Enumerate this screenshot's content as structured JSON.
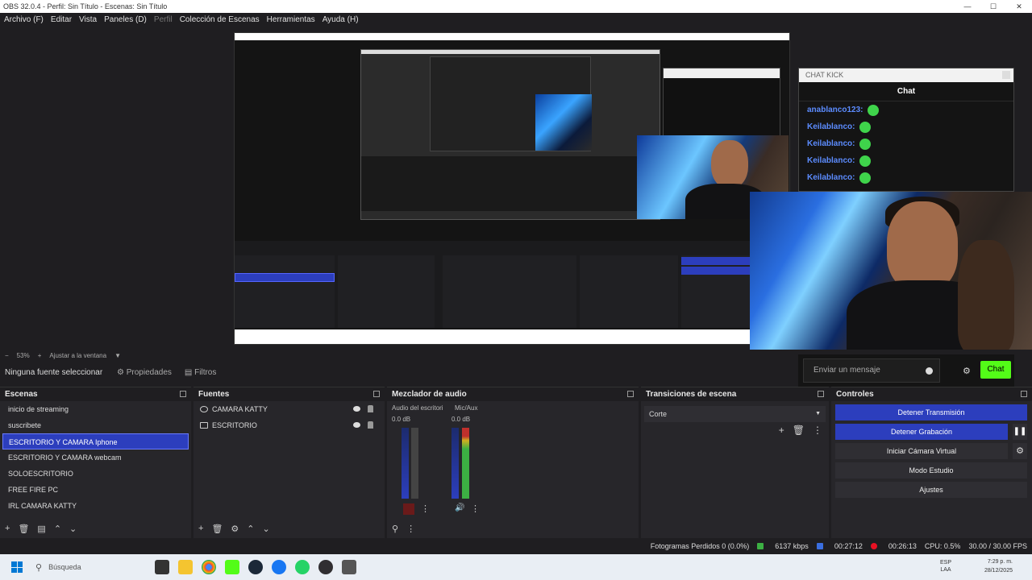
{
  "window": {
    "title": "OBS 32.0.4 - Perfil: Sin Título - Escenas: Sin Título"
  },
  "menu": [
    "Archivo (F)",
    "Editar",
    "Vista",
    "Paneles (D)",
    "Perfil",
    "Colección de Escenas",
    "Herramientas",
    "Ayuda (H)"
  ],
  "chat": {
    "window_title": "CHAT KICK",
    "header": "Chat",
    "messages": [
      {
        "user": "anablanco123:"
      },
      {
        "user": "Keilablanco:"
      },
      {
        "user": "Keilablanco:"
      },
      {
        "user": "Keilablanco:"
      },
      {
        "user": "Keilablanco:"
      }
    ],
    "input_placeholder": "Enviar un mensaje",
    "send_label": "Chat"
  },
  "zoom": {
    "value": "53%",
    "fit_label": "Ajustar a la ventana"
  },
  "source_toolbar": {
    "none_label": "Ninguna fuente seleccionar",
    "properties": "Propiedades",
    "filters": "Filtros"
  },
  "scenes": {
    "title": "Escenas",
    "items": [
      "inicio de streaming",
      "suscribete",
      "ESCRITORIO Y CAMARA Iphone",
      "ESCRITORIO Y CAMARA webcam",
      "SOLOESCRITORIO",
      "FREE FIRE PC",
      "IRL CAMARA KATTY"
    ],
    "selected_index": 2
  },
  "sources": {
    "title": "Fuentes",
    "items": [
      "CAMARA KATTY",
      "ESCRITORIO"
    ]
  },
  "mixer": {
    "title": "Mezclador de audio",
    "channels": [
      {
        "name": "Audio del escritori",
        "db": "0.0 dB"
      },
      {
        "name": "Mic/Aux",
        "db": "0.0 dB"
      }
    ],
    "scale": [
      "0",
      "-5",
      "-10",
      "-15",
      "-20",
      "-25",
      "-30",
      "-35",
      "-40",
      "-45",
      "-50",
      "-55",
      "-60"
    ]
  },
  "transitions": {
    "title": "Transiciones de escena",
    "selected": "Corte"
  },
  "controls": {
    "title": "Controles",
    "buttons": [
      "Detener Transmisión",
      "Detener Grabación",
      "Iniciar Cámara Virtual",
      "Modo Estudio",
      "Ajustes"
    ]
  },
  "status": {
    "dropped": "Fotogramas Perdidos 0 (0.0%)",
    "bitrate": "6137 kbps",
    "stream_time": "00:27:12",
    "rec_time": "00:26:13",
    "cpu": "CPU: 0.5%",
    "fps": "30.00 / 30.00 FPS"
  },
  "taskbar": {
    "search": "Búsqueda",
    "lang": "ESP",
    "lang2": "LAA",
    "time": "7:29 p. m.",
    "date": "28/12/2025"
  },
  "colors": {
    "accent": "#2c3ebd",
    "kick_green": "#53fc18",
    "rec_red": "#e81123"
  }
}
